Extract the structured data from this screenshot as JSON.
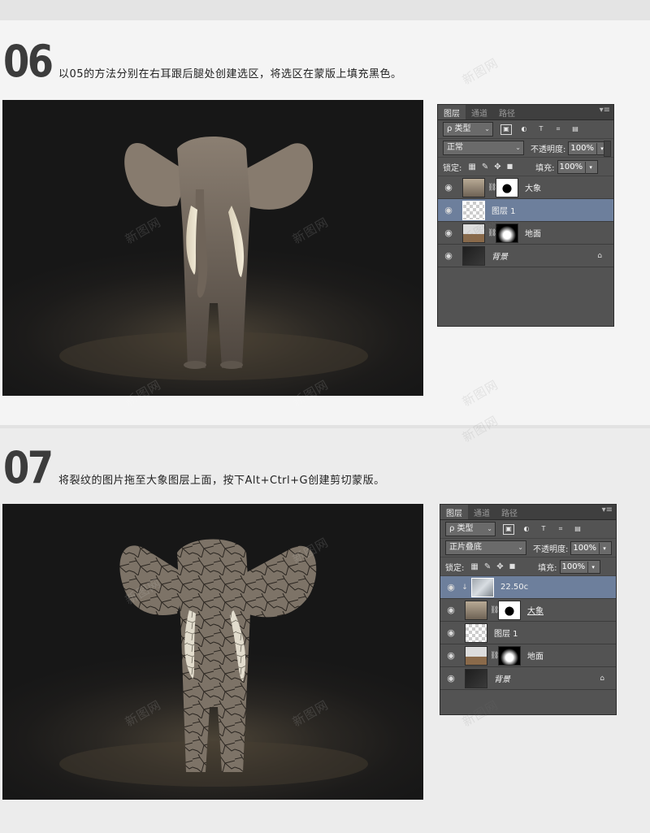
{
  "watermark": "新图网",
  "steps": [
    {
      "number": "06",
      "text": "以05的方法分别在右耳跟后腿处创建选区，将选区在蒙版上填充黑色。",
      "panel": {
        "tabs": [
          "图层",
          "通道",
          "路径"
        ],
        "menu_glyph": "▾≡",
        "filter_label": "ρ 类型",
        "filter_icons": [
          "▣",
          "◐",
          "T",
          "⌗",
          "▤"
        ],
        "blend_mode": "正常",
        "opacity_label": "不透明度:",
        "opacity_value": "100%",
        "lock_label": "锁定:",
        "lock_icons": [
          "▦",
          "✎",
          "✥",
          "🔒"
        ],
        "fill_label": "填充:",
        "fill_value": "100%",
        "layers": [
          {
            "name": "大象",
            "selected": false,
            "thumb": "elephant",
            "mask": true,
            "italic": false,
            "locked": false
          },
          {
            "name": "图层 1",
            "selected": true,
            "thumb": "checker",
            "mask": false,
            "italic": false,
            "locked": false
          },
          {
            "name": "地面",
            "selected": false,
            "thumb": "ground",
            "mask": true,
            "italic": false,
            "locked": false
          },
          {
            "name": "背景",
            "selected": false,
            "thumb": "dark",
            "mask": false,
            "italic": true,
            "locked": true
          }
        ]
      }
    },
    {
      "number": "07",
      "text": "将裂纹的图片拖至大象图层上面，按下Alt+Ctrl+G创建剪切蒙版。",
      "panel": {
        "tabs": [
          "图层",
          "通道",
          "路径"
        ],
        "menu_glyph": "▾≡",
        "filter_label": "ρ 类型",
        "filter_icons": [
          "▣",
          "◐",
          "T",
          "⌗",
          "▤"
        ],
        "blend_mode": "正片叠底",
        "opacity_label": "不透明度:",
        "opacity_value": "100%",
        "lock_label": "锁定:",
        "lock_icons": [
          "▦",
          "✎",
          "✥",
          "🔒"
        ],
        "fill_label": "填充:",
        "fill_value": "100%",
        "layers": [
          {
            "name": "22.50c",
            "selected": true,
            "thumb": "crack",
            "mask": false,
            "italic": false,
            "locked": false,
            "clipped": true
          },
          {
            "name": "大象",
            "selected": false,
            "thumb": "elephant",
            "mask": true,
            "italic": false,
            "locked": false,
            "underline": true
          },
          {
            "name": "图层 1",
            "selected": false,
            "thumb": "checker",
            "mask": false,
            "italic": false,
            "locked": false
          },
          {
            "name": "地面",
            "selected": false,
            "thumb": "ground",
            "mask": true,
            "italic": false,
            "locked": false
          },
          {
            "name": "背景",
            "selected": false,
            "thumb": "dark",
            "mask": false,
            "italic": true,
            "locked": true
          }
        ]
      }
    }
  ],
  "icons": {
    "eye": "eye-icon",
    "link": "chain-link-icon",
    "lock": "lock-icon"
  }
}
